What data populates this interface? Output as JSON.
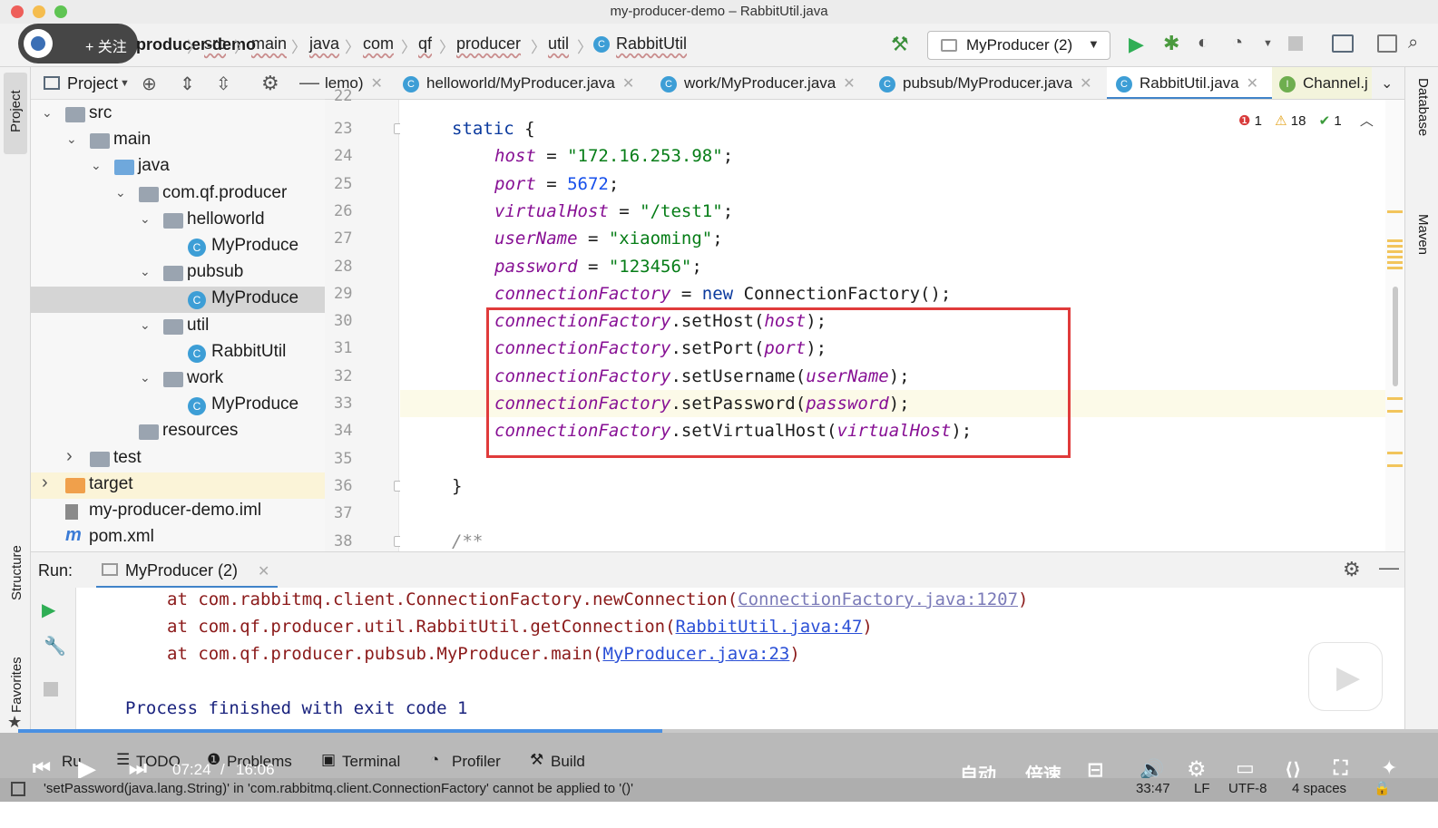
{
  "window": {
    "title": "my-producer-demo – RabbitUtil.java"
  },
  "overlay": {
    "follow_label": "+ 关注"
  },
  "breadcrumb": {
    "project": "producer-demo",
    "items": [
      "src",
      "main",
      "java",
      "com",
      "qf",
      "producer",
      "util",
      "RabbitUtil"
    ]
  },
  "toolbar": {
    "run_config": "MyProducer (2)"
  },
  "project_panel": {
    "title": "Project",
    "tree": [
      {
        "label": "src",
        "depth": 0,
        "type": "folder",
        "expanded": true
      },
      {
        "label": "main",
        "depth": 1,
        "type": "folder",
        "expanded": true
      },
      {
        "label": "java",
        "depth": 2,
        "type": "folder-blue",
        "expanded": true
      },
      {
        "label": "com.qf.producer",
        "depth": 3,
        "type": "package",
        "expanded": true
      },
      {
        "label": "helloworld",
        "depth": 4,
        "type": "package",
        "expanded": true
      },
      {
        "label": "MyProduce",
        "depth": 5,
        "type": "class"
      },
      {
        "label": "pubsub",
        "depth": 4,
        "type": "package",
        "expanded": true
      },
      {
        "label": "MyProduce",
        "depth": 5,
        "type": "class",
        "selected": true
      },
      {
        "label": "util",
        "depth": 4,
        "type": "package",
        "expanded": true
      },
      {
        "label": "RabbitUtil",
        "depth": 5,
        "type": "class"
      },
      {
        "label": "work",
        "depth": 4,
        "type": "package",
        "expanded": true
      },
      {
        "label": "MyProduce",
        "depth": 5,
        "type": "class"
      },
      {
        "label": "resources",
        "depth": 3,
        "type": "folder"
      },
      {
        "label": "test",
        "depth": 1,
        "type": "folder",
        "collapsed": true
      },
      {
        "label": "target",
        "depth": 0,
        "type": "folder-orange",
        "collapsed": true,
        "highlight": true
      },
      {
        "label": "my-producer-demo.iml",
        "depth": 0,
        "type": "file"
      },
      {
        "label": "pom.xml",
        "depth": 0,
        "type": "maven"
      }
    ]
  },
  "tabs": [
    {
      "label": "lemo)"
    },
    {
      "label": "helloworld/MyProducer.java"
    },
    {
      "label": "work/MyProducer.java"
    },
    {
      "label": "pubsub/MyProducer.java"
    },
    {
      "label": "RabbitUtil.java",
      "active": true
    },
    {
      "label": "Channel.j"
    }
  ],
  "inspections": {
    "errors": "1",
    "warnings": "18",
    "ok": "1"
  },
  "editor": {
    "first_partial_line": "22",
    "lines": [
      {
        "n": "23",
        "text": "static {"
      },
      {
        "n": "24",
        "text": "host = \"172.16.253.98\";"
      },
      {
        "n": "25",
        "text": "port = 5672;"
      },
      {
        "n": "26",
        "text": "virtualHost = \"/test1\";"
      },
      {
        "n": "27",
        "text": "userName = \"xiaoming\";"
      },
      {
        "n": "28",
        "text": "password = \"123456\";"
      },
      {
        "n": "29",
        "text": "connectionFactory = new ConnectionFactory();"
      },
      {
        "n": "30",
        "text": "connectionFactory.setHost(host);"
      },
      {
        "n": "31",
        "text": "connectionFactory.setPort(port);"
      },
      {
        "n": "32",
        "text": "connectionFactory.setUsername(userName);"
      },
      {
        "n": "33",
        "text": "connectionFactory.setPassword(password);"
      },
      {
        "n": "34",
        "text": "connectionFactory.setVirtualHost(virtualHost);"
      },
      {
        "n": "35",
        "text": ""
      },
      {
        "n": "36",
        "text": "}"
      },
      {
        "n": "37",
        "text": ""
      },
      {
        "n": "38",
        "text": "/**"
      }
    ]
  },
  "run_panel": {
    "label": "Run:",
    "tab": "MyProducer (2)",
    "console": [
      {
        "prefix": "at com.rabbitmq.client.ConnectionFactory.newConnection(",
        "link": "ConnectionFactory.java:1207",
        "suffix": ")"
      },
      {
        "prefix": "at com.qf.producer.util.RabbitUtil.getConnection(",
        "link": "RabbitUtil.java:47",
        "suffix": ")"
      },
      {
        "prefix": "at com.qf.producer.pubsub.MyProducer.main(",
        "link": "MyProducer.java:23",
        "suffix": ")"
      }
    ],
    "exit_message": "Process finished with exit code 1"
  },
  "bottom_tools": [
    "Ru",
    "TODO",
    "Problems",
    "Terminal",
    "Profiler",
    "Build"
  ],
  "video": {
    "time_current": "07:24",
    "time_sep": "/",
    "time_total": "16:06",
    "auto_label": "自动",
    "speed_label": "倍速",
    "progress": 0.45
  },
  "status": {
    "message": "'setPassword(java.lang.String)' in 'com.rabbitmq.client.ConnectionFactory' cannot be applied to '()'",
    "position": "33:47",
    "line_sep": "LF",
    "encoding": "UTF-8",
    "indent": "4 spaces"
  },
  "side_tools": {
    "left_top": "Project",
    "left_mid": "Structure",
    "left_bottom": "Favorites",
    "right_top": "Database",
    "right_mid": "Maven"
  },
  "colors": {
    "accent": "#3d9ed6",
    "highlight_box": "#e03b3b",
    "run_green": "#2fae55"
  }
}
